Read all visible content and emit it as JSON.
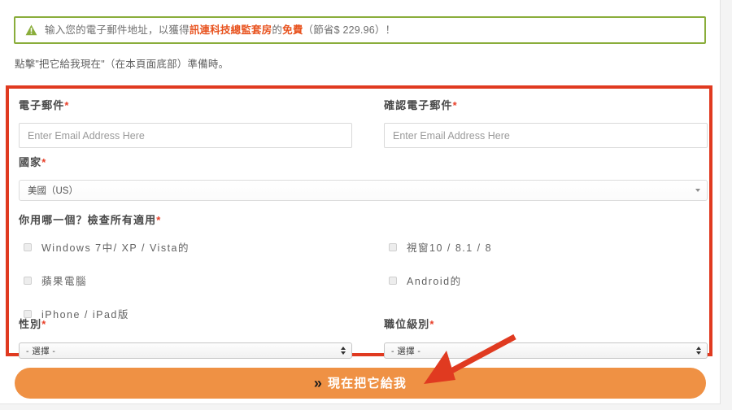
{
  "alert": {
    "icon": "warning-triangle-icon",
    "text_part1": "输入您的電子郵件地址，以獲得",
    "text_highlight1": "訊連科技總監套房",
    "text_part2": "的",
    "text_highlight2": "免費",
    "text_part3": "（節省$ 229.96）！",
    "border_color": "#8aad3b",
    "highlight_color": "#e8531f"
  },
  "subnote": "點擊\"把它給我現在\"（在本頁面底部）準備時。",
  "form": {
    "border_color": "#e03a20",
    "email": {
      "label": "電子郵件",
      "required_mark": "*",
      "value": "",
      "placeholder": "Enter Email Address Here"
    },
    "email_confirm": {
      "label": "確認電子郵件",
      "required_mark": "*",
      "value": "",
      "placeholder": "Enter Email Address Here"
    },
    "country": {
      "label": "國家",
      "required_mark": "*",
      "selected": "美國（US）"
    },
    "os_question": {
      "label": "你用哪一個？檢查所有適用",
      "required_mark": "*",
      "options_left": [
        {
          "label": "Windows 7中/ XP / Vista的",
          "checked": false
        },
        {
          "label": "蘋果電腦",
          "checked": false
        },
        {
          "label": "iPhone / iPad版",
          "checked": false
        }
      ],
      "options_right": [
        {
          "label": "視窗10 / 8.1 / 8",
          "checked": false
        },
        {
          "label": "Android的",
          "checked": false
        }
      ]
    },
    "gender": {
      "label": "性別",
      "required_mark": "*",
      "selected": "- 選擇 -"
    },
    "job_level": {
      "label": "職位級別",
      "required_mark": "*",
      "selected": "- 選擇 -"
    }
  },
  "submit": {
    "chevron": "»",
    "label": "現在把它給我",
    "color": "#ef9144"
  },
  "annotation": {
    "arrow_color": "#e03a20",
    "arrow_name": "red-pointer-arrow"
  }
}
